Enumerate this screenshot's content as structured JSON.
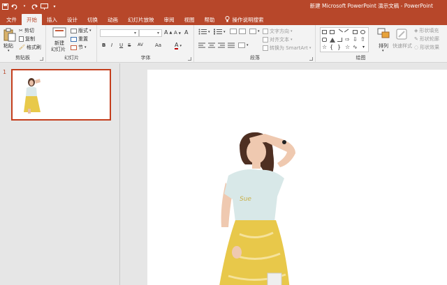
{
  "window": {
    "title": "新建 Microsoft PowerPoint 演示文稿 - PowerPoint",
    "qat": {
      "save_icon": "save-icon",
      "undo_icon": "undo-icon",
      "redo_icon": "redo-icon",
      "present_icon": "present-icon",
      "customize_icon": "customize-icon"
    }
  },
  "tabs": [
    {
      "label": "文件"
    },
    {
      "label": "开始"
    },
    {
      "label": "插入"
    },
    {
      "label": "设计"
    },
    {
      "label": "切换"
    },
    {
      "label": "动画"
    },
    {
      "label": "幻灯片放映"
    },
    {
      "label": "审阅"
    },
    {
      "label": "视图"
    },
    {
      "label": "帮助"
    },
    {
      "label": "操作说明搜索"
    }
  ],
  "ribbon": {
    "clipboard": {
      "label": "剪贴板",
      "paste": "粘贴",
      "cut": "剪切",
      "copy": "复制",
      "format_painter": "格式刷"
    },
    "slides": {
      "label": "幻灯片",
      "new_slide": "新建",
      "new_slide2": "幻灯片",
      "layout": "版式",
      "reset": "重置",
      "section": "节"
    },
    "font": {
      "label": "字体",
      "font_name": "",
      "font_size": "",
      "bold": "B",
      "italic": "I",
      "underline": "U",
      "strike": "S",
      "spacing": "AV",
      "case": "Aa",
      "clear": "A",
      "grow": "A",
      "shrink": "A",
      "color": "A"
    },
    "paragraph": {
      "label": "段落",
      "text_direction": "文字方向",
      "align_text": "对齐文本",
      "smartart": "转换为 SmartArt"
    },
    "drawing": {
      "label": "绘图",
      "arrange": "排列",
      "quick_styles": "快速样式",
      "fill": "形状填充",
      "outline": "形状轮廓",
      "effects": "形状效果"
    }
  },
  "thumbnails": [
    {
      "number": "1"
    }
  ],
  "colors": {
    "accent": "#b7472a",
    "thumb_border": "#c43e1c",
    "background": "#e6e6e6"
  }
}
